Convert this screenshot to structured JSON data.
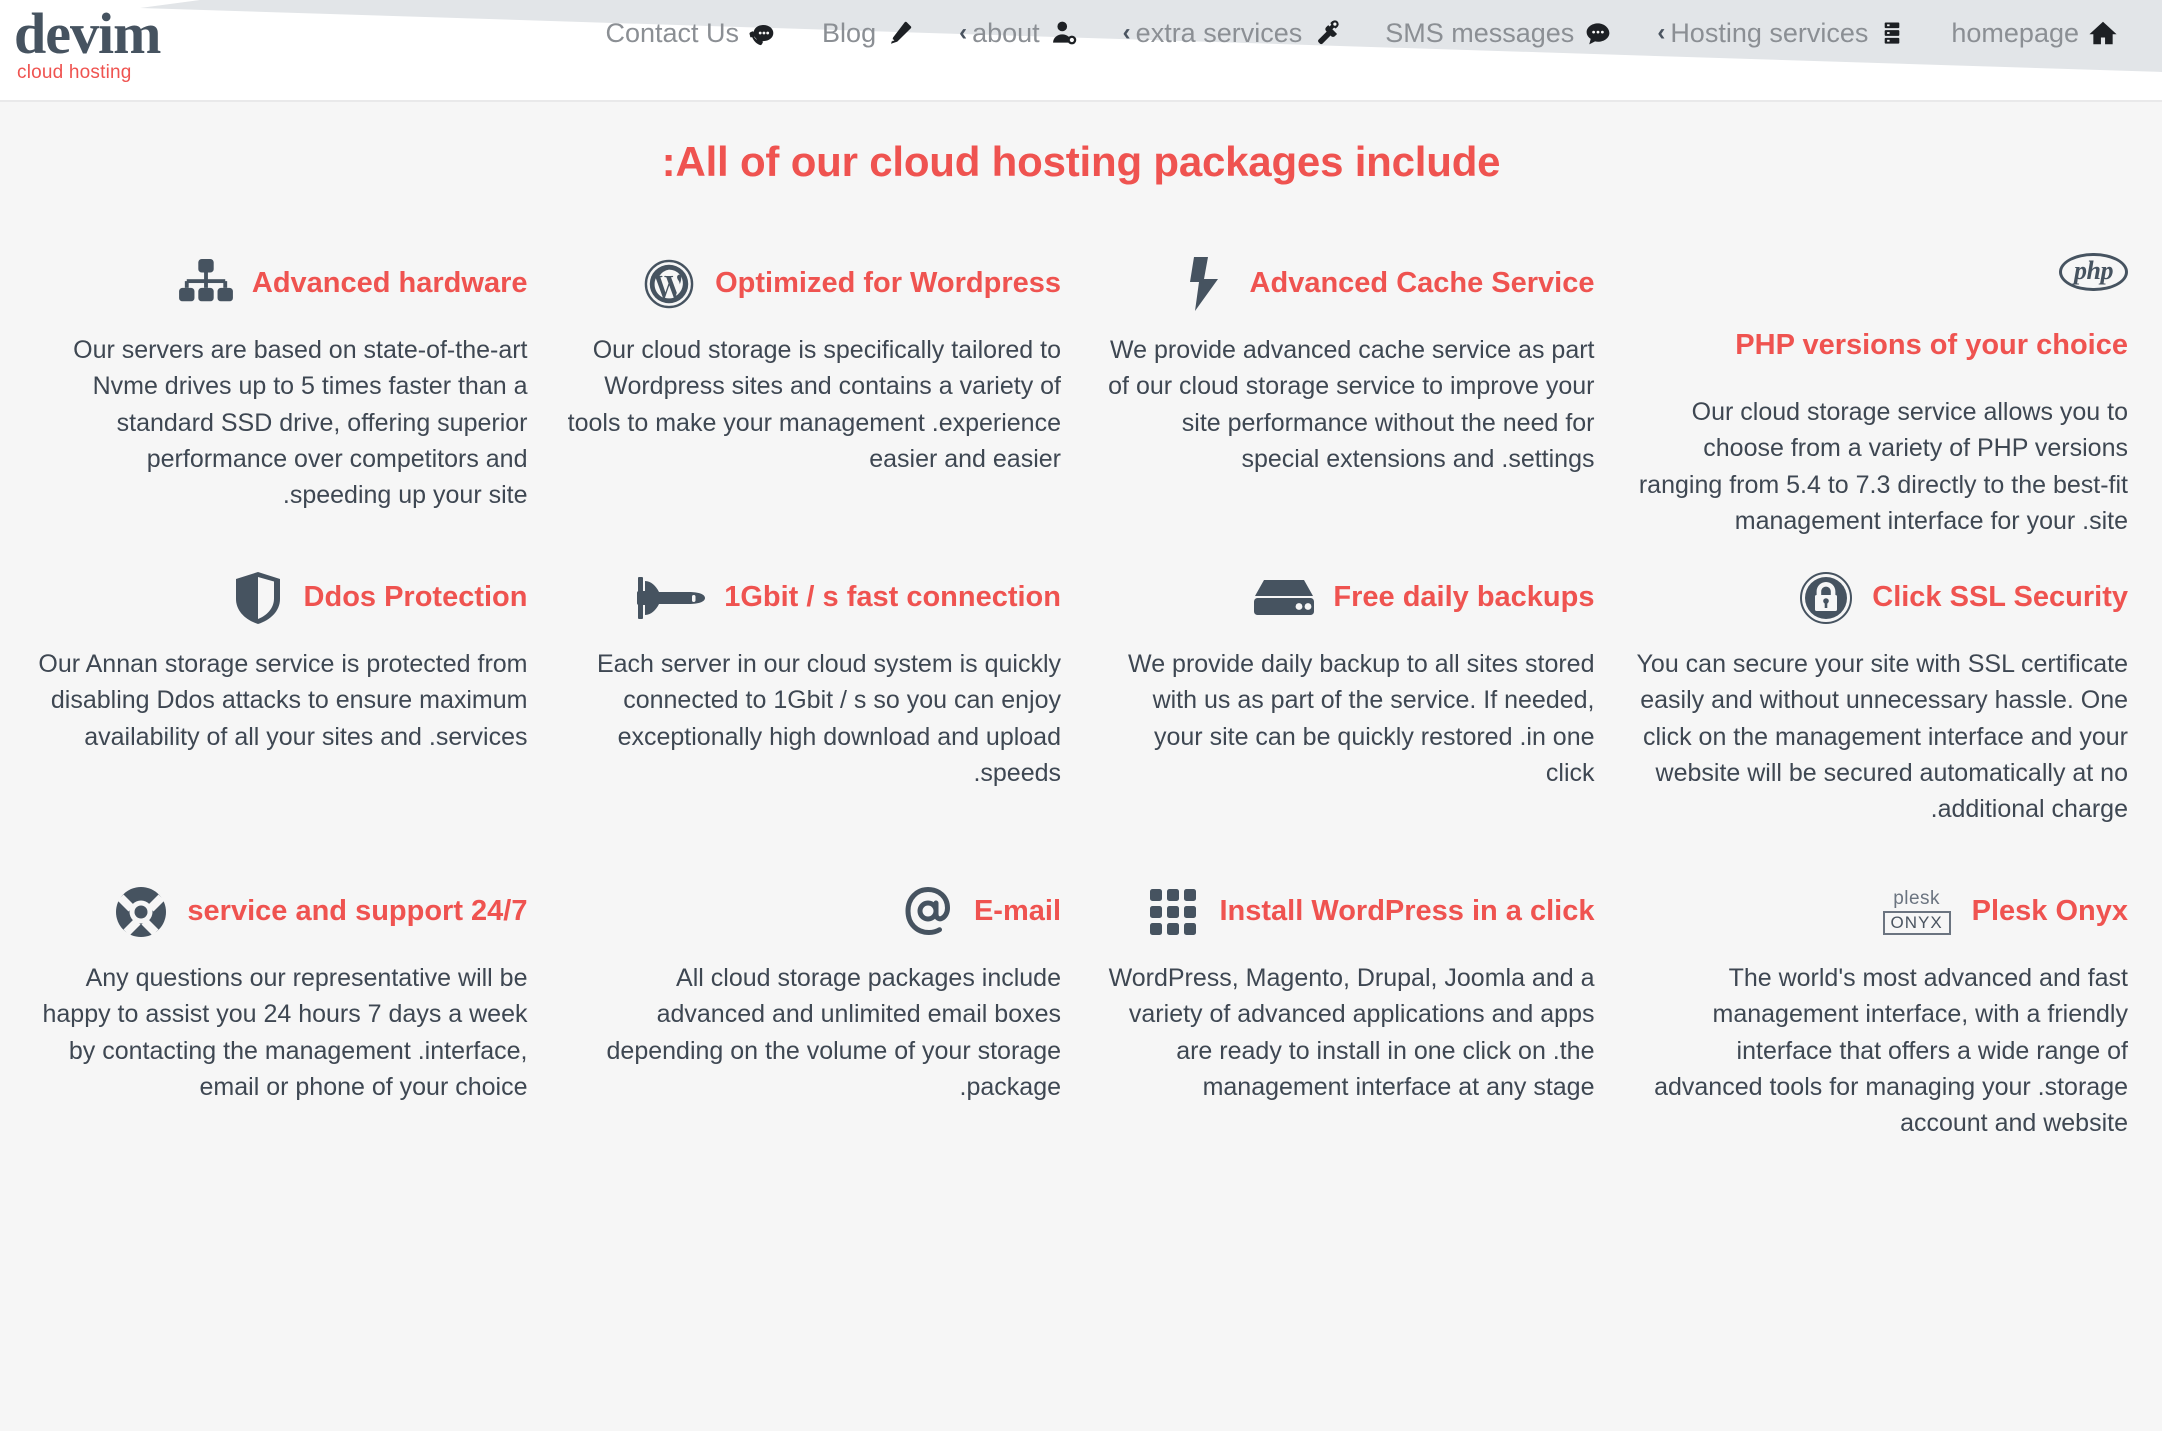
{
  "brand": {
    "name": "devim",
    "tagline": "cloud hosting"
  },
  "colors": {
    "accent_red": "#ef5350",
    "slate": "#465360",
    "body_text": "#3e4752",
    "nav_text": "#8b8f94",
    "page_bg": "#f6f6f6",
    "header_band": "#e2e5e8"
  },
  "nav": {
    "items": [
      {
        "label": "Contact Us",
        "icon": "phone-chat-icon",
        "caret": "",
        "has_caret": false
      },
      {
        "label": "Blog",
        "icon": "pencil-icon",
        "caret": "",
        "has_caret": false
      },
      {
        "label": "about",
        "icon": "user-icon",
        "caret": "‹",
        "has_caret": true
      },
      {
        "label": "extra services",
        "icon": "tools-icon",
        "caret": "‹",
        "has_caret": true
      },
      {
        "label": "SMS messages",
        "icon": "chat-bubble-icon",
        "caret": "",
        "has_caret": false
      },
      {
        "label": "Hosting services",
        "icon": "server-rack-icon",
        "caret": "‹",
        "has_caret": true
      },
      {
        "label": "homepage",
        "icon": "home-icon",
        "caret": "",
        "has_caret": false
      }
    ]
  },
  "main": {
    "section_title": ":All of our cloud hosting packages include",
    "features": [
      {
        "title": "Advanced hardware",
        "icon": "sitemap-icon",
        "layout": "inline",
        "text": "Our servers are based on state-of-the-art Nvme drives up to 5 times faster than a standard SSD drive, offering superior performance over competitors and .speeding up your site"
      },
      {
        "title": "Optimized for Wordpress",
        "icon": "wordpress-icon",
        "layout": "inline",
        "text": "Our cloud storage is specifically tailored to Wordpress sites and contains a variety of tools to make your management .experience easier and easier"
      },
      {
        "title": "Advanced Cache Service",
        "icon": "lightning-bolt-icon",
        "layout": "inline",
        "text": "We provide advanced cache service as part of our cloud storage service to improve your site performance without the need for special extensions and .settings"
      },
      {
        "title": "PHP versions of your choice",
        "icon": "php-icon",
        "layout": "stacked",
        "text": "Our cloud storage service allows you to choose from a variety of PHP versions ranging from 5.4 to 7.3 directly to the best-fit management interface for your .site"
      },
      {
        "title": "Ddos Protection",
        "icon": "shield-icon",
        "layout": "inline",
        "text": "Our Annan storage service is protected from disabling Ddos attacks to ensure maximum availability of all your sites and .services"
      },
      {
        "title": "1Gbit / s fast connection",
        "icon": "space-shuttle-icon",
        "layout": "inline",
        "text": "Each server in our cloud system is quickly connected to 1Gbit / s so you can enjoy exceptionally high download and upload .speeds"
      },
      {
        "title": "Free daily backups",
        "icon": "hard-drive-icon",
        "layout": "inline",
        "text": "We provide daily backup to all sites stored with us as part of the service. If needed, your site can be quickly restored .in one click"
      },
      {
        "title": "Click SSL Security",
        "icon": "lock-circle-icon",
        "layout": "inline",
        "text": "You can secure your site with SSL certificate easily and without unnecessary hassle. One click on the management interface and your website will be secured automatically at no .additional charge"
      },
      {
        "title": "service and support 24/7",
        "icon": "life-ring-icon",
        "layout": "inline",
        "text": "Any questions our representative will be happy to assist you 24 hours 7 days a week by contacting the management .interface, email or phone of your choice"
      },
      {
        "title": "E-mail",
        "icon": "at-sign-icon",
        "layout": "inline",
        "text": "All cloud storage packages include advanced and unlimited email boxes depending on the volume of your storage .package"
      },
      {
        "title": "Install WordPress in a click",
        "icon": "app-grid-icon",
        "layout": "inline",
        "text": "WordPress, Magento, Drupal, Joomla and a variety of advanced applications and apps are ready to install in one click on .the management interface at any stage"
      },
      {
        "title": "Plesk Onyx",
        "icon": "plesk-onyx-icon",
        "layout": "inline",
        "text": "The world's most advanced and fast management interface, with a friendly interface that offers a wide range of advanced tools for managing your .storage account and website",
        "plesk_word": "plesk",
        "plesk_box": "ONYX"
      }
    ]
  }
}
